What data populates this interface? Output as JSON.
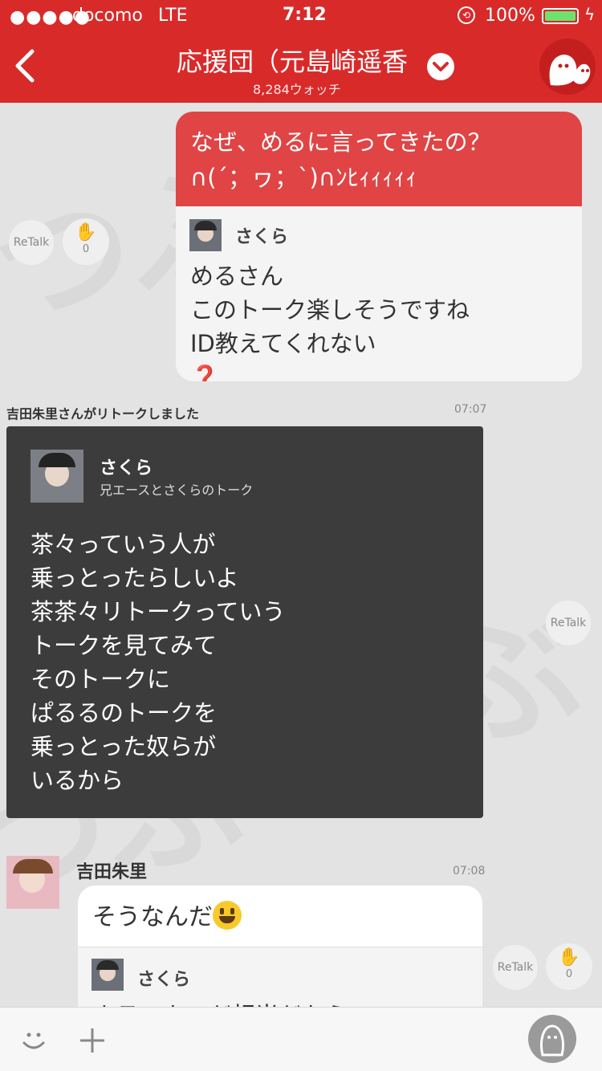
{
  "status_bar": {
    "dots": "●●●●●",
    "carrier": "docomo",
    "network": "LTE",
    "time": "7:12",
    "battery": "100%"
  },
  "header": {
    "title": "応援団（元島崎遥香",
    "watch_count": "8,284ウォッチ"
  },
  "messages": {
    "m1": {
      "lines": [
        "なぜ、めるに言ってきたの？",
        "∩(´；ヮ；`)∩ﾝﾋｨｨｨｨｨ"
      ],
      "quote_name": "さくら",
      "quote_lines": [
        "めるさん",
        "このトーク楽しそうですね",
        "ID教えてくれない"
      ],
      "quote_mark": "❓",
      "retalk_label": "ReTalk",
      "clap_count": "0"
    },
    "retalk_notice": {
      "text": "吉田朱里さんがリトークしました",
      "time": "07:07",
      "name": "さくら",
      "subtitle": "兄エースとさくらのトーク",
      "lines": [
        "茶々っていう人が",
        "乗っとったらしいよ",
        "茶茶々リトークっていう",
        "トークを見てみて",
        "そのトークに",
        "ぱるるのトークを",
        "乗っとった奴らが",
        "いるから"
      ],
      "retalk_label": "ReTalk"
    },
    "m3": {
      "name": "吉田朱里",
      "time": "07:08",
      "text": "そうなんだ",
      "quote_name": "さくら",
      "quote_partial": "ホラーカモだ相当だから",
      "retalk_label": "ReTalk",
      "clap_count": "0"
    }
  },
  "watermark": "つぶ",
  "colors": {
    "accent": "#d92a2a",
    "bubble_red": "#e04444",
    "dark_card": "#3c3c3c"
  }
}
